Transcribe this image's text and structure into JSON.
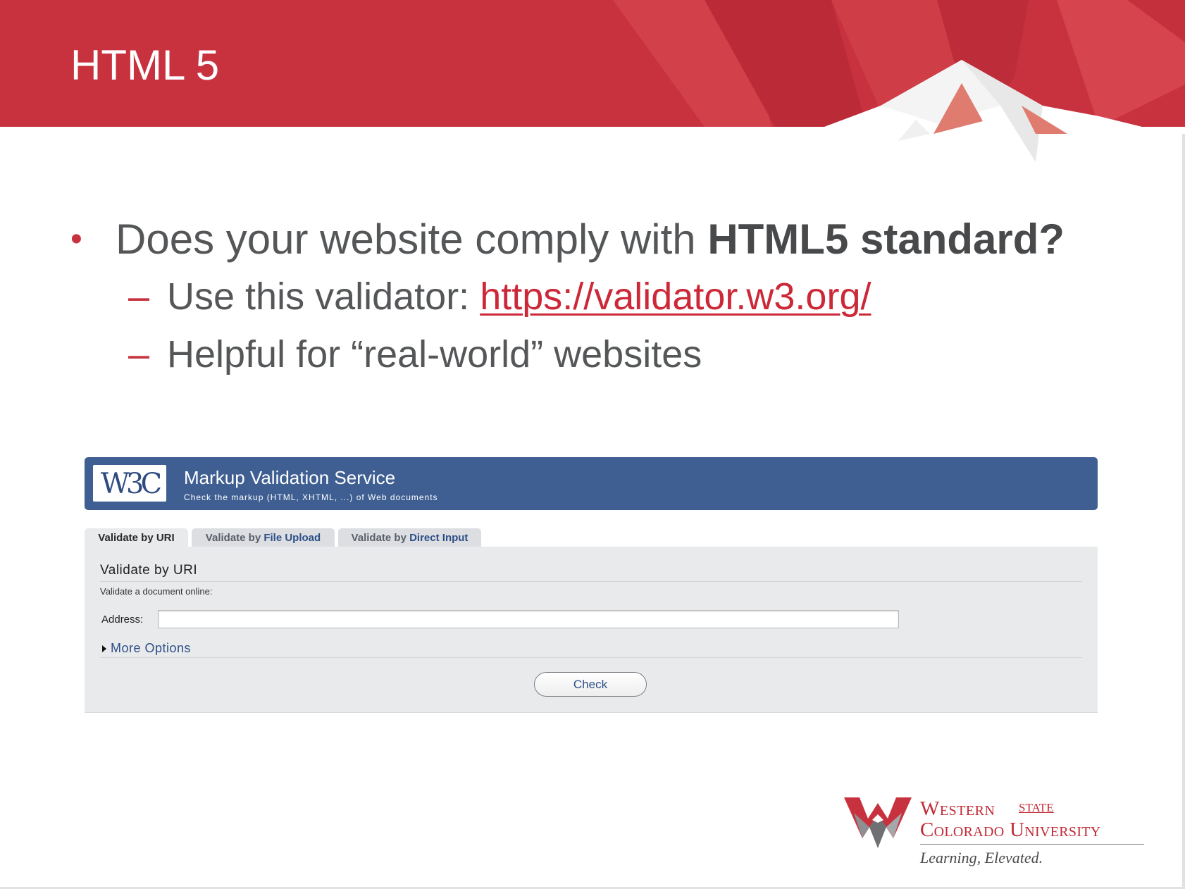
{
  "slide": {
    "title": "HTML 5",
    "bullet_1": {
      "text": "Does your website comply with ",
      "bold": "HTML5 standard?"
    },
    "sub_1": {
      "text": "Use this validator: ",
      "link": "https://validator.w3.org/"
    },
    "sub_2": {
      "text": "Helpful for “real-world” websites"
    }
  },
  "validator": {
    "logo": "W3C",
    "title": "Markup Validation Service",
    "subtitle": "Check the markup (HTML, XHTML, ...) of Web documents",
    "tabs": [
      {
        "prefix": "Validate by ",
        "label": "URI",
        "active": true
      },
      {
        "prefix": "Validate by ",
        "label": "File Upload",
        "active": false
      },
      {
        "prefix": "Validate by ",
        "label": "Direct Input",
        "active": false
      }
    ],
    "panel_title": "Validate by URI",
    "panel_desc": "Validate a document online:",
    "address_label": "Address:",
    "address_value": "",
    "more_options": "More Options",
    "check_label": "Check"
  },
  "university": {
    "name_line_1": "Western",
    "state": "STATE",
    "name_line_2": "Colorado University",
    "tagline": "Learning, Elevated."
  },
  "colors": {
    "brand_red": "#c8323e",
    "w3c_blue": "#3f5f93",
    "text_gray": "#545658"
  }
}
